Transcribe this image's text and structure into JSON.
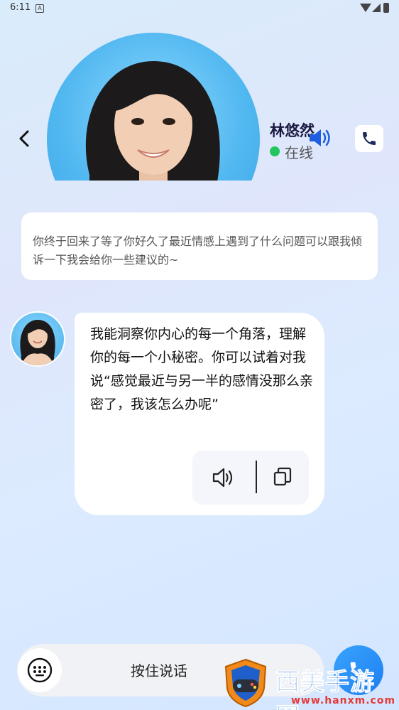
{
  "status_bar": {
    "time": "6:11",
    "notification_icon": "A"
  },
  "header": {
    "contact_name": "林悠然",
    "status": "在线",
    "status_color": "#22c55e"
  },
  "greeting_message": "你终于回来了等了你好久了最近情感上遇到了什么问题可以跟我倾诉一下我会给你一些建议的~",
  "chat": {
    "messages": [
      {
        "sender": "ai",
        "text": "我能洞察你内心的每一个角落，理解你的每一个小秘密。你可以试着对我说“感觉最近与另一半的感情没那么亲密了，我该怎么办呢”"
      }
    ]
  },
  "input_bar": {
    "hold_to_speak": "按住说话"
  },
  "watermark": {
    "title": "西美手游网",
    "url": "www.hanxm.com"
  },
  "icons": {
    "back": "chevron-left-icon",
    "speaker": "speaker-icon",
    "phone": "phone-icon",
    "copy": "copy-icon",
    "keyboard": "keyboard-icon"
  },
  "colors": {
    "accent": "#1d7ef0",
    "online": "#22c55e"
  }
}
